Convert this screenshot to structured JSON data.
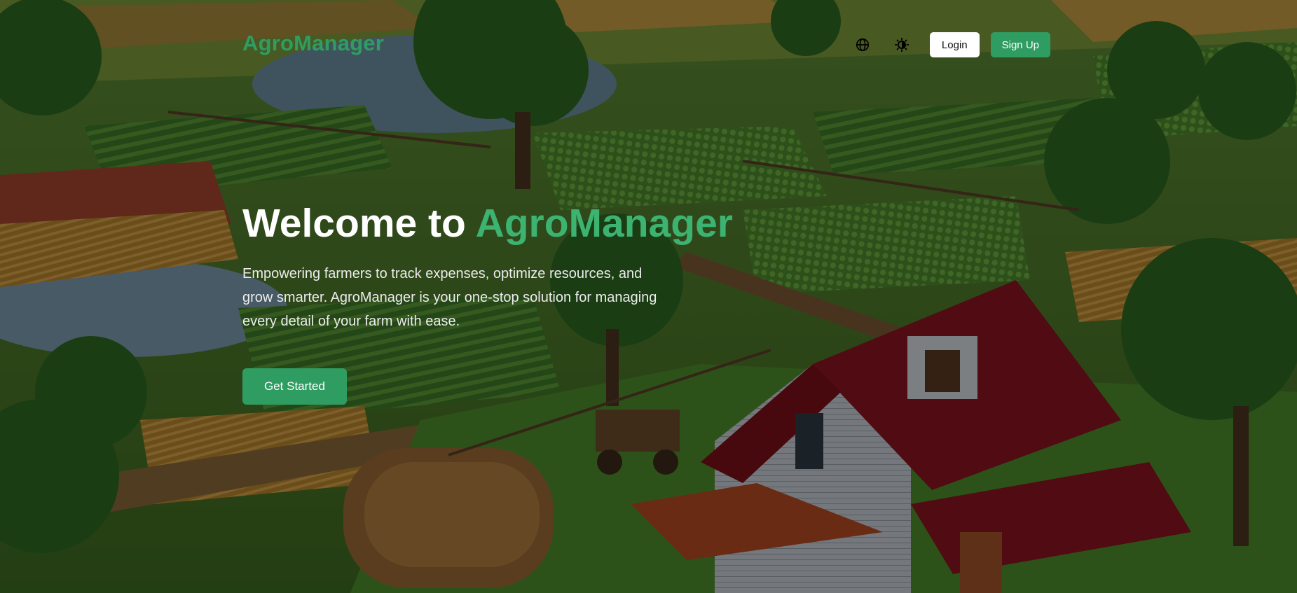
{
  "navbar": {
    "brand": "AgroManager",
    "language_icon": "globe-icon",
    "theme_icon": "theme-toggle-icon",
    "login_label": "Login",
    "signup_label": "Sign Up"
  },
  "hero": {
    "title_prefix": "Welcome to ",
    "title_accent": "AgroManager",
    "subtitle": "Empowering farmers to track expenses, optimize resources, and grow smarter. AgroManager is your one-stop solution for managing every detail of your farm with ease.",
    "cta_label": "Get Started",
    "background_image": "farm-landscape-illustration"
  },
  "colors": {
    "brand_green": "#2f9d62",
    "accent_green": "#3cb371",
    "overlay": "rgba(0,0,0,0.42)",
    "roof_red": "#8b1620"
  }
}
